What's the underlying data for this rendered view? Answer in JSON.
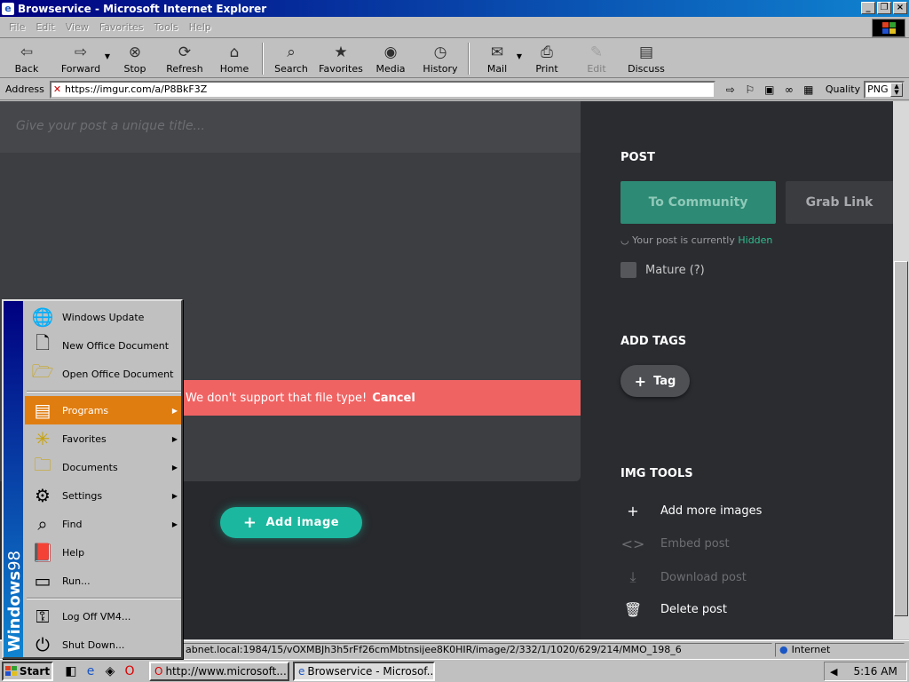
{
  "window": {
    "title": "Browservice - Microsoft Internet Explorer"
  },
  "menu": [
    "File",
    "Edit",
    "View",
    "Favorites",
    "Tools",
    "Help"
  ],
  "toolbar": {
    "back": "Back",
    "forward": "Forward",
    "stop": "Stop",
    "refresh": "Refresh",
    "home": "Home",
    "search": "Search",
    "favorites": "Favorites",
    "media": "Media",
    "history": "History",
    "mail": "Mail",
    "print": "Print",
    "edit": "Edit",
    "discuss": "Discuss"
  },
  "address": {
    "label": "Address",
    "url": "https://imgur.com/a/P8BkF3Z",
    "quality_label": "Quality",
    "quality_value": "PNG"
  },
  "page": {
    "title_placeholder": "Give your post a unique title...",
    "error_text": "We don't support that file type!",
    "error_action": "Cancel",
    "add_image": "Add image",
    "post_heading": "POST",
    "to_community": "To Community",
    "grab_link": "Grab Link",
    "visibility_prefix": "Your post is currently",
    "visibility_value": "Hidden",
    "mature_label": "Mature (?)",
    "tags_heading": "ADD TAGS",
    "tag_button": "Tag",
    "tools_heading": "IMG TOOLS",
    "tools": [
      "Add more images",
      "Embed post",
      "Download post",
      "Delete post"
    ],
    "colors": {
      "accent": "#1bb79e",
      "error": "#f06363",
      "hidden": "#2fbf8f"
    }
  },
  "statusbar": {
    "url": "abnet.local:1984/15/vOXMBJh3h5rFf26cmMbtnsijee8K0HIR/image/2/332/1/1020/629/214/MMO_198_6",
    "zone": "Internet"
  },
  "startmenu": {
    "brand_bold": "Windows",
    "brand_num": "98",
    "items": [
      "Windows Update",
      "New Office Document",
      "Open Office Document",
      "Programs",
      "Favorites",
      "Documents",
      "Settings",
      "Find",
      "Help",
      "Run...",
      "Log Off VM4...",
      "Shut Down..."
    ]
  },
  "taskbar": {
    "start": "Start",
    "tasks": [
      "http://www.microsoft...",
      "Browservice - Microsof..."
    ],
    "clock": "5:16 AM"
  }
}
